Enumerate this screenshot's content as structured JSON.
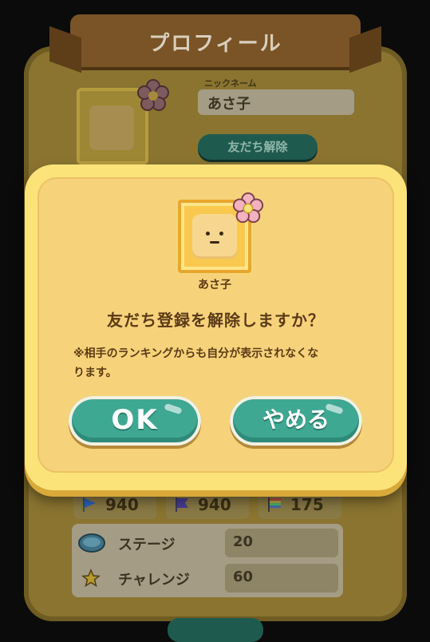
{
  "screen": {
    "title": "プロフィール",
    "background_profile": {
      "nickname_label": "ニックネーム",
      "nickname_value": "あさ子",
      "unfriend_button": "友だち解除",
      "stats": [
        {
          "icon": "blue-flag-icon",
          "value": "940"
        },
        {
          "icon": "purple-flag-icon",
          "value": "940"
        },
        {
          "icon": "rainbow-flag-icon",
          "value": "175"
        }
      ],
      "rows": [
        {
          "icon": "stage-oval-icon",
          "label": "ステージ",
          "value": "20"
        },
        {
          "icon": "star-icon",
          "label": "チャレンジ",
          "value": "60"
        }
      ]
    }
  },
  "dialog": {
    "avatar_name": "あさ子",
    "question": "友だち登録を解除しますか？",
    "note_line1": "※相手のランキングからも自分が表示されなくな",
    "note_line2": "ります。",
    "ok_label": "OK",
    "cancel_label": "やめる"
  },
  "colors": {
    "dialog_fill": "#f6d37a",
    "dialog_border": "#fbe37a",
    "button_teal": "#3ea893",
    "text_brown": "#5b3a17"
  }
}
